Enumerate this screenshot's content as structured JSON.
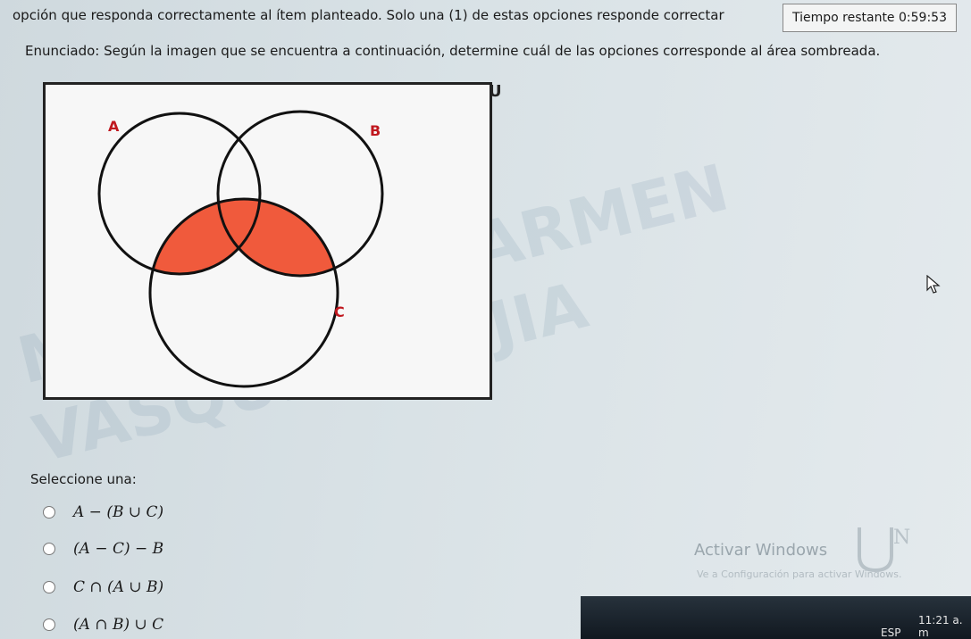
{
  "question": {
    "instruction": "opción que responda correctamente al ítem planteado. Solo una (1) de estas opciones responde correctar",
    "statement": "Enunciado: Según la imagen que se encuentra a continuación, determine cuál de las opciones corresponde al área sombreada."
  },
  "timer": {
    "label": "Tiempo restante",
    "value": "0:59:53"
  },
  "venn": {
    "universe_label": "U",
    "set_a_label": "A",
    "set_b_label": "B",
    "set_c_label": "C",
    "shade_color": "#f05a3c"
  },
  "watermark": {
    "line1": "MARIA DEL CARMEN",
    "line2": "VASQUEZ MEJIA"
  },
  "answers": {
    "prompt": "Seleccione una:",
    "options": [
      {
        "label": "A − (B ∪ C)"
      },
      {
        "label": "(A − C) − B"
      },
      {
        "label": "C ∩ (A ∪ B)"
      },
      {
        "label": "(A ∩ B) ∪ C"
      }
    ]
  },
  "os": {
    "activate_title": "Activar Windows",
    "activate_subtitle": "Ve a Configuración para activar Windows.",
    "language": "ESP",
    "clock": "11:21 a. m"
  }
}
